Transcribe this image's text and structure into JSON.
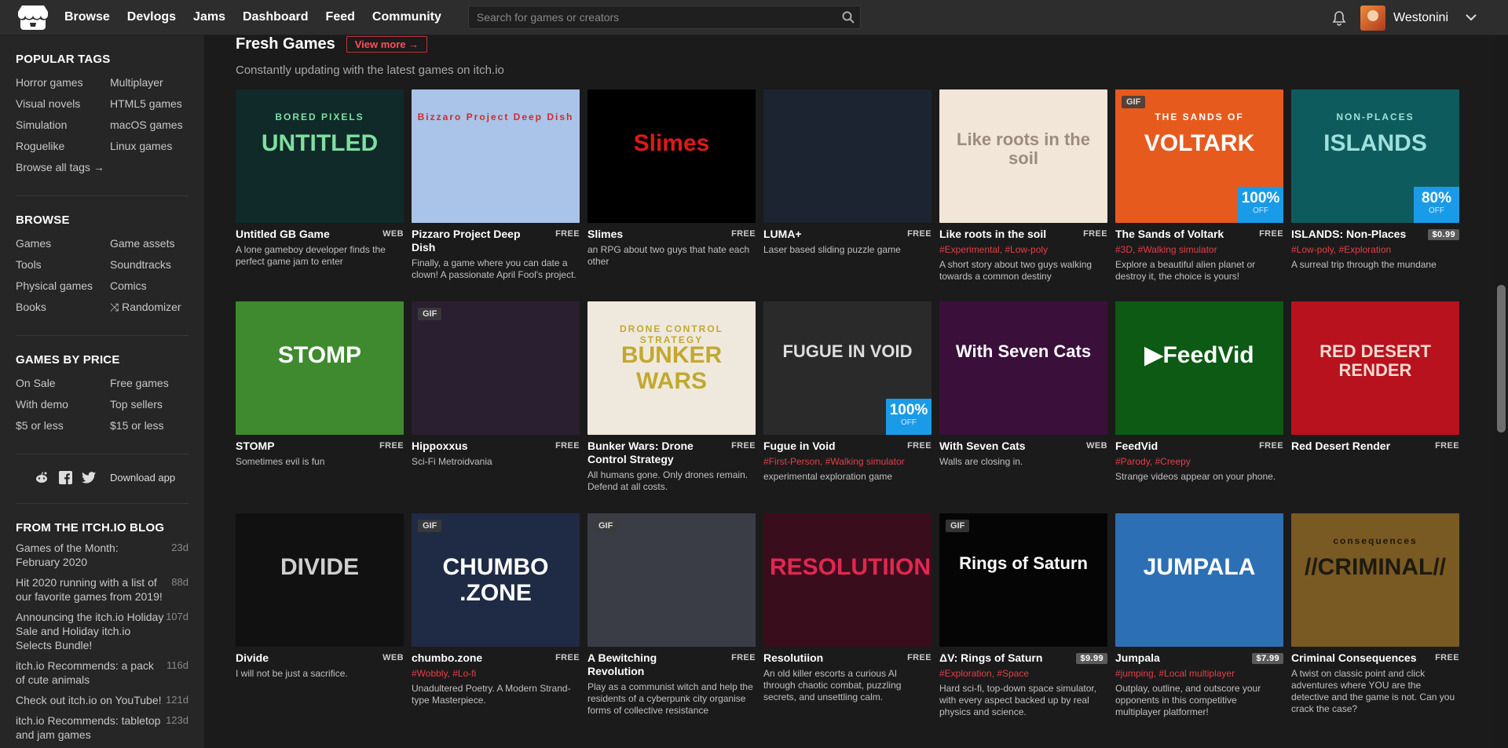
{
  "topbar": {
    "nav": [
      "Browse",
      "Devlogs",
      "Jams",
      "Dashboard",
      "Feed",
      "Community"
    ],
    "search_placeholder": "Search for games or creators",
    "username": "Westonini"
  },
  "sidebar": {
    "popular_tags_title": "POPULAR TAGS",
    "popular_tags": [
      "Horror games",
      "Multiplayer",
      "Visual novels",
      "HTML5 games",
      "Simulation",
      "macOS games",
      "Roguelike",
      "Linux games",
      "Browse all tags →"
    ],
    "browse_title": "BROWSE",
    "browse": [
      "Games",
      "Game assets",
      "Tools",
      "Soundtracks",
      "Physical games",
      "Comics",
      "Books",
      "⤨ Randomizer"
    ],
    "price_title": "GAMES BY PRICE",
    "price": [
      "On Sale",
      "Free games",
      "With demo",
      "Top sellers",
      "$5 or less",
      "$15 or less"
    ],
    "download_app": "Download app",
    "blog_title": "FROM THE ITCH.IO BLOG",
    "blog": [
      {
        "title": "Games of the Month: February 2020",
        "age": "23d"
      },
      {
        "title": "Hit 2020 running with a list of our favorite games from 2019!",
        "age": "88d"
      },
      {
        "title": "Announcing the itch.io Holiday Sale and Holiday itch.io Selects Bundle!",
        "age": "107d"
      },
      {
        "title": "itch.io Recommends: a pack of cute animals",
        "age": "116d"
      },
      {
        "title": "Check out itch.io on YouTube!",
        "age": "121d"
      },
      {
        "title": "itch.io Recommends: tabletop and jam games",
        "age": "123d"
      }
    ]
  },
  "main": {
    "title": "Fresh Games",
    "view_more": "View more →",
    "subtitle": "Constantly updating with the latest games on itch.io",
    "games": [
      {
        "title": "Untitled GB Game",
        "price": "WEB",
        "tags": "",
        "desc": "A lone gameboy developer finds the perfect game jam to enter",
        "cover_text": "UNTITLED",
        "cover_sub": "BORED PIXELS",
        "bg": "#0f2a28",
        "fg": "#7ee0a0",
        "gif": false,
        "sale": ""
      },
      {
        "title": "Pizzaro Project Deep Dish",
        "price": "FREE",
        "tags": "",
        "desc": "Finally, a game where you can date a clown! A passionate April Fool's project.",
        "cover_text": "",
        "cover_sub": "Bizzaro Project Deep Dish",
        "bg": "#a9c4e8",
        "fg": "#d12a2a",
        "gif": false,
        "sale": ""
      },
      {
        "title": "Slimes",
        "price": "FREE",
        "tags": "",
        "desc": "an RPG about two guys that hate each other",
        "cover_text": "Slimes",
        "cover_sub": "",
        "bg": "#000000",
        "fg": "#e01818",
        "gif": false,
        "sale": ""
      },
      {
        "title": "LUMA+",
        "price": "FREE",
        "tags": "",
        "desc": "Laser based sliding puzzle game",
        "cover_text": "",
        "cover_sub": "",
        "bg": "#1b2430",
        "fg": "#3cd66b",
        "gif": false,
        "sale": ""
      },
      {
        "title": "Like roots in the soil",
        "price": "FREE",
        "tags": "#Experimental, #Low-poly",
        "desc": "A short story about two guys walking towards a common destiny",
        "cover_text": "Like roots in the soil",
        "cover_sub": "",
        "bg": "#f2e6d8",
        "fg": "#9a8d80",
        "gif": false,
        "sale": ""
      },
      {
        "title": "The Sands of Voltark",
        "price": "FREE",
        "tags": "#3D, #Walking simulator",
        "desc": "Explore a beautiful alien planet or destroy it, the choice is yours!",
        "cover_text": "VOLTARK",
        "cover_sub": "THE SANDS OF",
        "bg": "#e65a1e",
        "fg": "#ffffff",
        "gif": true,
        "sale": "100%"
      },
      {
        "title": "ISLANDS: Non-Places",
        "price": "$0.99",
        "tags": "#Low-poly, #Exploration",
        "desc": "A surreal trip through the mundane",
        "cover_text": "ISLANDS",
        "cover_sub": "NON-PLACES",
        "bg": "#0e5b5d",
        "fg": "#9fe0dc",
        "gif": false,
        "sale": "80%"
      },
      {
        "title": "STOMP",
        "price": "FREE",
        "tags": "",
        "desc": "Sometimes evil is fun",
        "cover_text": "STOMP",
        "cover_sub": "",
        "bg": "#3f8a2f",
        "fg": "#ffffff",
        "gif": false,
        "sale": ""
      },
      {
        "title": "Hippoxxus",
        "price": "FREE",
        "tags": "",
        "desc": "Sci-Fi Metroidvania",
        "cover_text": "",
        "cover_sub": "",
        "bg": "#2a1f30",
        "fg": "#5ac0e0",
        "gif": true,
        "sale": ""
      },
      {
        "title": "Bunker Wars: Drone Control Strategy",
        "price": "FREE",
        "tags": "",
        "desc": "All humans gone. Only drones remain. Defend at all costs.",
        "cover_text": "BUNKER WARS",
        "cover_sub": "DRONE CONTROL STRATEGY",
        "bg": "#efe9dd",
        "fg": "#c2a830",
        "gif": false,
        "sale": ""
      },
      {
        "title": "Fugue in Void",
        "price": "FREE",
        "tags": "#First-Person, #Walking simulator",
        "desc": "experimental exploration game",
        "cover_text": "FUGUE IN VOID",
        "cover_sub": "",
        "bg": "#2a2a2a",
        "fg": "#dddddd",
        "gif": false,
        "sale": "100%"
      },
      {
        "title": "With Seven Cats",
        "price": "WEB",
        "tags": "",
        "desc": "Walls are closing in.",
        "cover_text": "With Seven Cats",
        "cover_sub": "",
        "bg": "#3a0f3a",
        "fg": "#ffffff",
        "gif": false,
        "sale": ""
      },
      {
        "title": "FeedVid",
        "price": "FREE",
        "tags": "#Parody, #Creepy",
        "desc": "Strange videos appear on your phone.",
        "cover_text": "▶FeedVid",
        "cover_sub": "",
        "bg": "#0c5a14",
        "fg": "#ffffff",
        "gif": false,
        "sale": ""
      },
      {
        "title": "Red Desert Render",
        "price": "FREE",
        "tags": "",
        "desc": "",
        "cover_text": "RED DESERT RENDER",
        "cover_sub": "",
        "bg": "#b8121e",
        "fg": "#f3d9d0",
        "gif": false,
        "sale": ""
      },
      {
        "title": "Divide",
        "price": "WEB",
        "tags": "",
        "desc": "I will not be just a sacrifice.",
        "cover_text": "DIVIDE",
        "cover_sub": "",
        "bg": "#111111",
        "fg": "#cfcfcf",
        "gif": false,
        "sale": ""
      },
      {
        "title": "chumbo.zone",
        "price": "FREE",
        "tags": "#Wobbly, #Lo-fi",
        "desc": "Unadultered Poetry. A Modern Strand-type Masterpiece.",
        "cover_text": "CHUMBO .ZONE",
        "cover_sub": "",
        "bg": "#1f2a44",
        "fg": "#ffffff",
        "gif": true,
        "sale": ""
      },
      {
        "title": "A Bewitching Revolution",
        "price": "FREE",
        "tags": "",
        "desc": "Play as a communist witch and help the residents of a cyberpunk city organise forms of collective resistance",
        "cover_text": "",
        "cover_sub": "",
        "bg": "#3a3d45",
        "fg": "#ff9aa8",
        "gif": true,
        "sale": ""
      },
      {
        "title": "Resolutiion",
        "price": "FREE",
        "tags": "",
        "desc": "An old killer escorts a curious AI through chaotic combat, puzzling secrets, and unsettling calm.",
        "cover_text": "RESOLUTIION",
        "cover_sub": "",
        "bg": "#3a0d1d",
        "fg": "#e02850",
        "gif": false,
        "sale": ""
      },
      {
        "title": "ΔV: Rings of Saturn",
        "price": "$9.99",
        "tags": "#Exploration, #Space",
        "desc": "Hard sci-fi, top-down space simulator, with every aspect backed up by real physics and science.",
        "cover_text": "Rings of Saturn",
        "cover_sub": "",
        "bg": "#050505",
        "fg": "#ffffff",
        "gif": true,
        "sale": ""
      },
      {
        "title": "Jumpala",
        "price": "$7.99",
        "tags": "#jumping, #Local multiplayer",
        "desc": "Outplay, outline, and outscore your opponents in this competitive multiplayer platformer!",
        "cover_text": "JUMPALA",
        "cover_sub": "",
        "bg": "#2d6fb5",
        "fg": "#ffffff",
        "gif": false,
        "sale": ""
      },
      {
        "title": "Criminal Consequences",
        "price": "FREE",
        "tags": "",
        "desc": "A twist on classic point and click adventures where YOU are the detective and the game is not. Can you crack the case?",
        "cover_text": "//CRIMINAL//",
        "cover_sub": "consequences",
        "bg": "#7a5a23",
        "fg": "#1e1a10",
        "gif": false,
        "sale": ""
      }
    ]
  },
  "ui": {
    "off_label": "OFF",
    "gif_label": "GIF"
  }
}
